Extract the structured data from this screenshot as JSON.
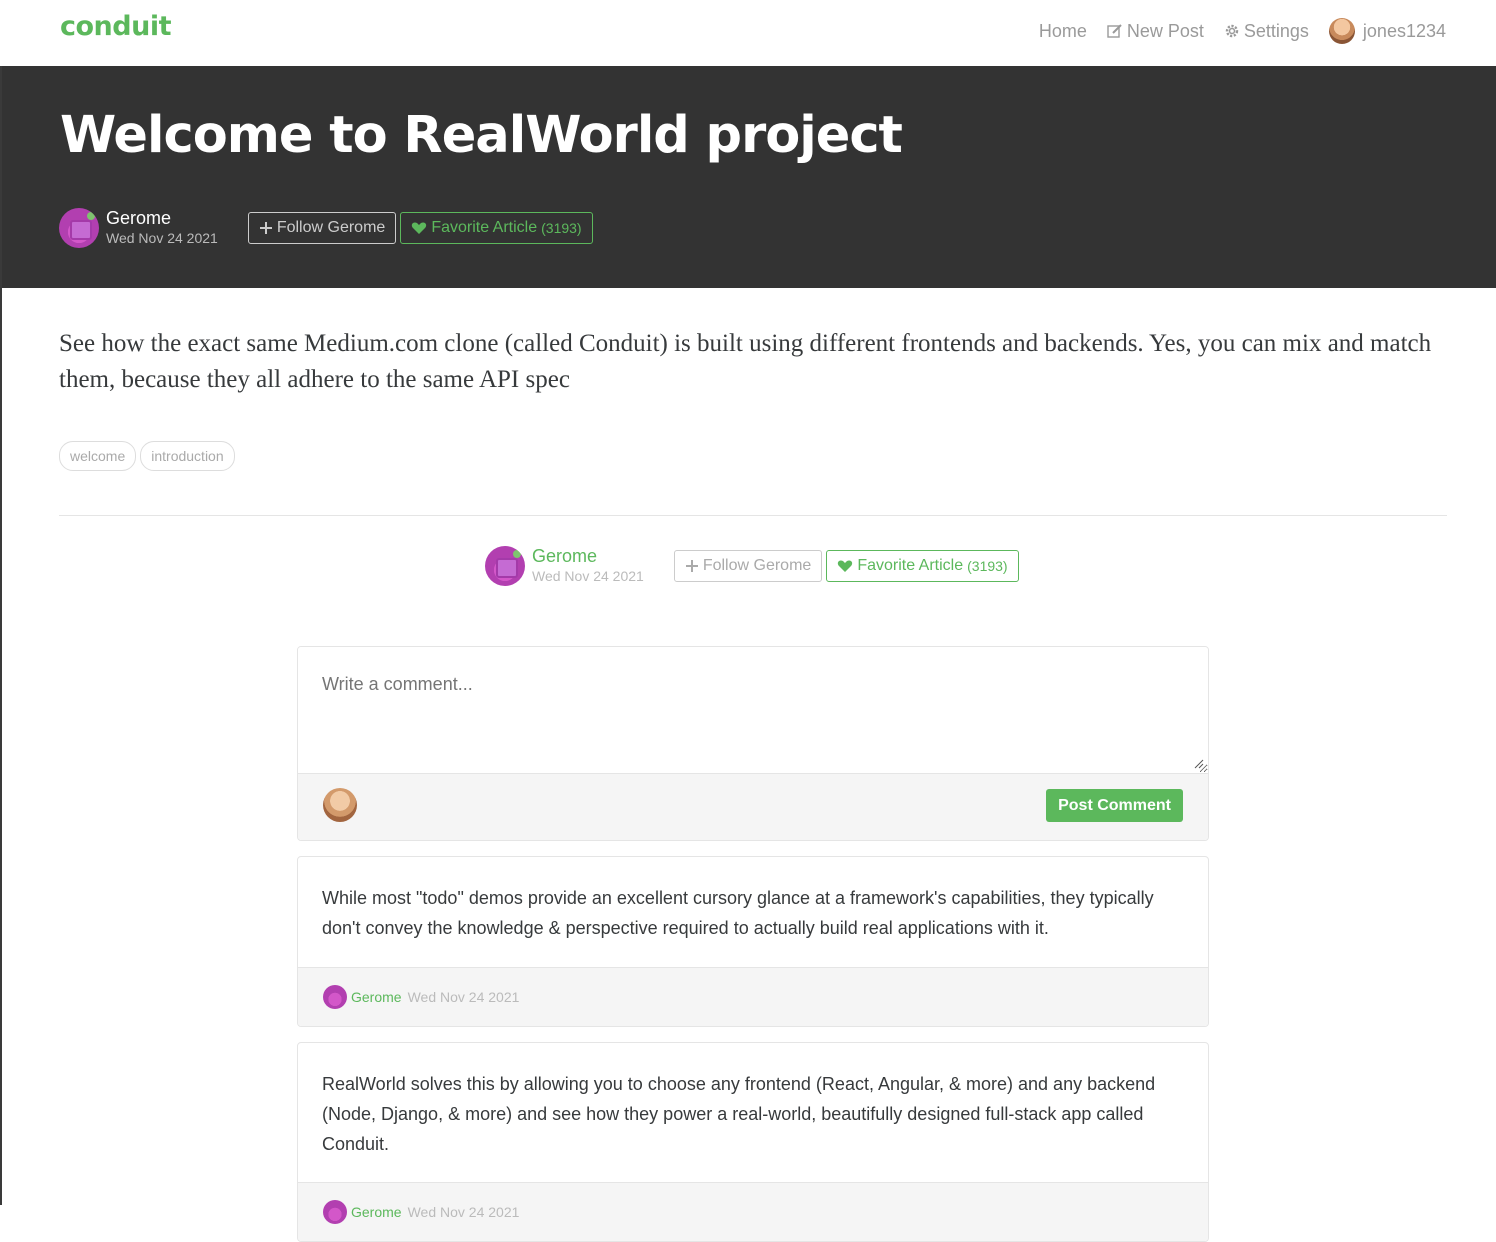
{
  "nav": {
    "brand": "conduit",
    "home": "Home",
    "new_post": "New Post",
    "settings": "Settings",
    "username": "jones1234"
  },
  "article": {
    "title": "Welcome to RealWorld project",
    "author": "Gerome",
    "date": "Wed Nov 24 2021",
    "follow_label": "Follow Gerome",
    "favorite_label": "Favorite Article",
    "favorite_count": "(3193)",
    "body": "See how the exact same Medium.com clone (called Conduit) is built using different frontends and backends. Yes, you can mix and match them, because they all adhere to the same API spec",
    "tags": [
      "welcome",
      "introduction"
    ]
  },
  "comment_form": {
    "placeholder": "Write a comment...",
    "submit_label": "Post Comment"
  },
  "comments": [
    {
      "body": "While most \"todo\" demos provide an excellent cursory glance at a framework's capabilities, they typically don't convey the knowledge & perspective required to actually build real applications with it.",
      "author": "Gerome",
      "date": "Wed Nov 24 2021"
    },
    {
      "body": "RealWorld solves this by allowing you to choose any frontend (React, Angular, & more) and any backend (Node, Django, & more) and see how they power a real-world, beautifully designed full-stack app called Conduit.",
      "author": "Gerome",
      "date": "Wed Nov 24 2021"
    }
  ],
  "colors": {
    "brand_green": "#5cb85c",
    "banner_bg": "#333333"
  }
}
